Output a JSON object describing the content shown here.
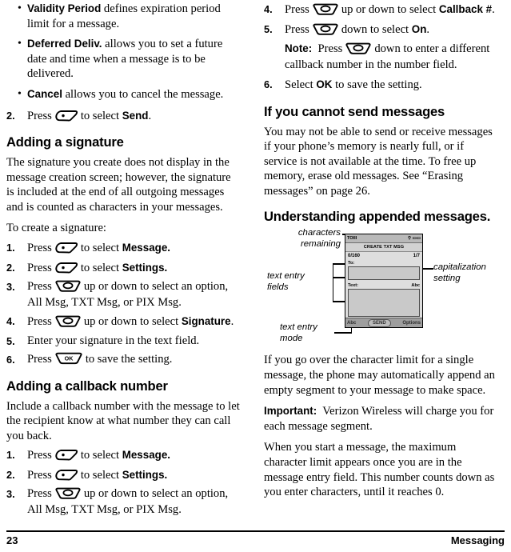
{
  "page": {
    "number": "23",
    "section": "Messaging"
  },
  "left_column": {
    "bullets": [
      {
        "term": "Validity Period",
        "text": " defines expiration period limit for a message."
      },
      {
        "term": "Deferred Deliv.",
        "text": " allows you to set a future date and time when a message is to be delivered."
      },
      {
        "term": "Cancel",
        "text": " allows you to cancel the message."
      }
    ],
    "step_send": {
      "num": "2.",
      "pre": "Press",
      "key": "select-key",
      "mid": "to select",
      "bold": "Send",
      "post": "."
    },
    "heading_signature": "Adding a signature",
    "para_signature": "The signature you create does not display in the message creation screen; however, the signature is included at the end of all outgoing messages and is counted as characters in your messages.",
    "para_to_create": "To create a signature:",
    "signature_steps": [
      {
        "num": "1.",
        "pre": "Press",
        "key": "select-key",
        "mid": "to select",
        "bold": "Message.",
        "post": ""
      },
      {
        "num": "2.",
        "pre": "Press",
        "key": "select-key",
        "mid": "to select",
        "bold": "Settings.",
        "post": ""
      },
      {
        "num": "3.",
        "pre": "Press",
        "key": "nav-key",
        "mid": "up or down to select an option,",
        "bold": "",
        "post": "",
        "line2": "All Msg, TXT Msg, or PIX Msg."
      },
      {
        "num": "4.",
        "pre": "Press",
        "key": "nav-key",
        "mid": "up or down to select",
        "bold": "Signature",
        "post": "."
      },
      {
        "num": "5.",
        "pre": "Enter your signature in the text field.",
        "key": "",
        "mid": "",
        "bold": "",
        "post": ""
      },
      {
        "num": "6.",
        "pre": "Press",
        "key": "ok-key",
        "mid": "to save the setting.",
        "bold": "",
        "post": ""
      }
    ],
    "heading_callback": "Adding a callback number",
    "para_callback": "Include a callback number with the message to let the recipient know at what number they can call you back.",
    "callback_steps": [
      {
        "num": "1.",
        "pre": "Press",
        "key": "select-key",
        "mid": "to select",
        "bold": "Message.",
        "post": ""
      },
      {
        "num": "2.",
        "pre": "Press",
        "key": "select-key",
        "mid": "to select",
        "bold": "Settings.",
        "post": ""
      },
      {
        "num": "3.",
        "pre": "Press",
        "key": "nav-key",
        "mid": "up or down to select an option,",
        "bold": "",
        "post": "",
        "line2": "All Msg, TXT Msg, or PIX Msg."
      }
    ]
  },
  "right_column": {
    "callback_steps_cont": [
      {
        "num": "4.",
        "pre": "Press",
        "key": "nav-key",
        "mid": "up or down to select",
        "bold": "Callback #",
        "post": "."
      },
      {
        "num": "5.",
        "pre": "Press",
        "key": "nav-key",
        "mid": "down to select",
        "bold": "On",
        "post": "."
      }
    ],
    "note": {
      "label": "Note:",
      "pre": "Press",
      "key": "nav-key",
      "mid": "down to enter a different callback number in the number field."
    },
    "step_ok": {
      "num": "6.",
      "pre": "Select",
      "bold": "OK",
      "post": "to save the setting."
    },
    "heading_cannot_send": "If you cannot send messages",
    "para_cannot_send": "You may not be able to send or receive messages if your phone’s memory is nearly full, or if service is not available at the time. To free up memory, erase old messages. See “Erasing messages” on page 26.",
    "heading_appended": "Understanding appended messages",
    "heading_appended_suffix": ".",
    "diagram": {
      "callouts": {
        "characters_remaining": "characters\nremaining",
        "text_entry_fields": "text entry\nfields",
        "text_entry_mode": "text entry\nmode",
        "capitalization_setting": "capitalization\nsetting"
      },
      "phone": {
        "status_signal": "TOIII",
        "status_right": "⚲ ▭▭",
        "title": "CREATE TXT MSG",
        "counter_left": "0/160",
        "counter_right": "1/7",
        "to_label": "To:",
        "text_label": "Text:",
        "caps_indicator": "Abc",
        "softkey_left": "Abc",
        "softkey_center": "SEND",
        "softkey_right": "Options"
      }
    },
    "para_over_limit": "If you go over the character limit for a single message, the phone may automatically append an empty segment to your message to make space.",
    "important": {
      "label": "Important:",
      "text": "Verizon Wireless will charge you for each message segment."
    },
    "para_max_limit": "When you start a message, the maximum character limit appears once you are in the message entry field. This number counts down as you enter characters, until it reaches 0."
  }
}
